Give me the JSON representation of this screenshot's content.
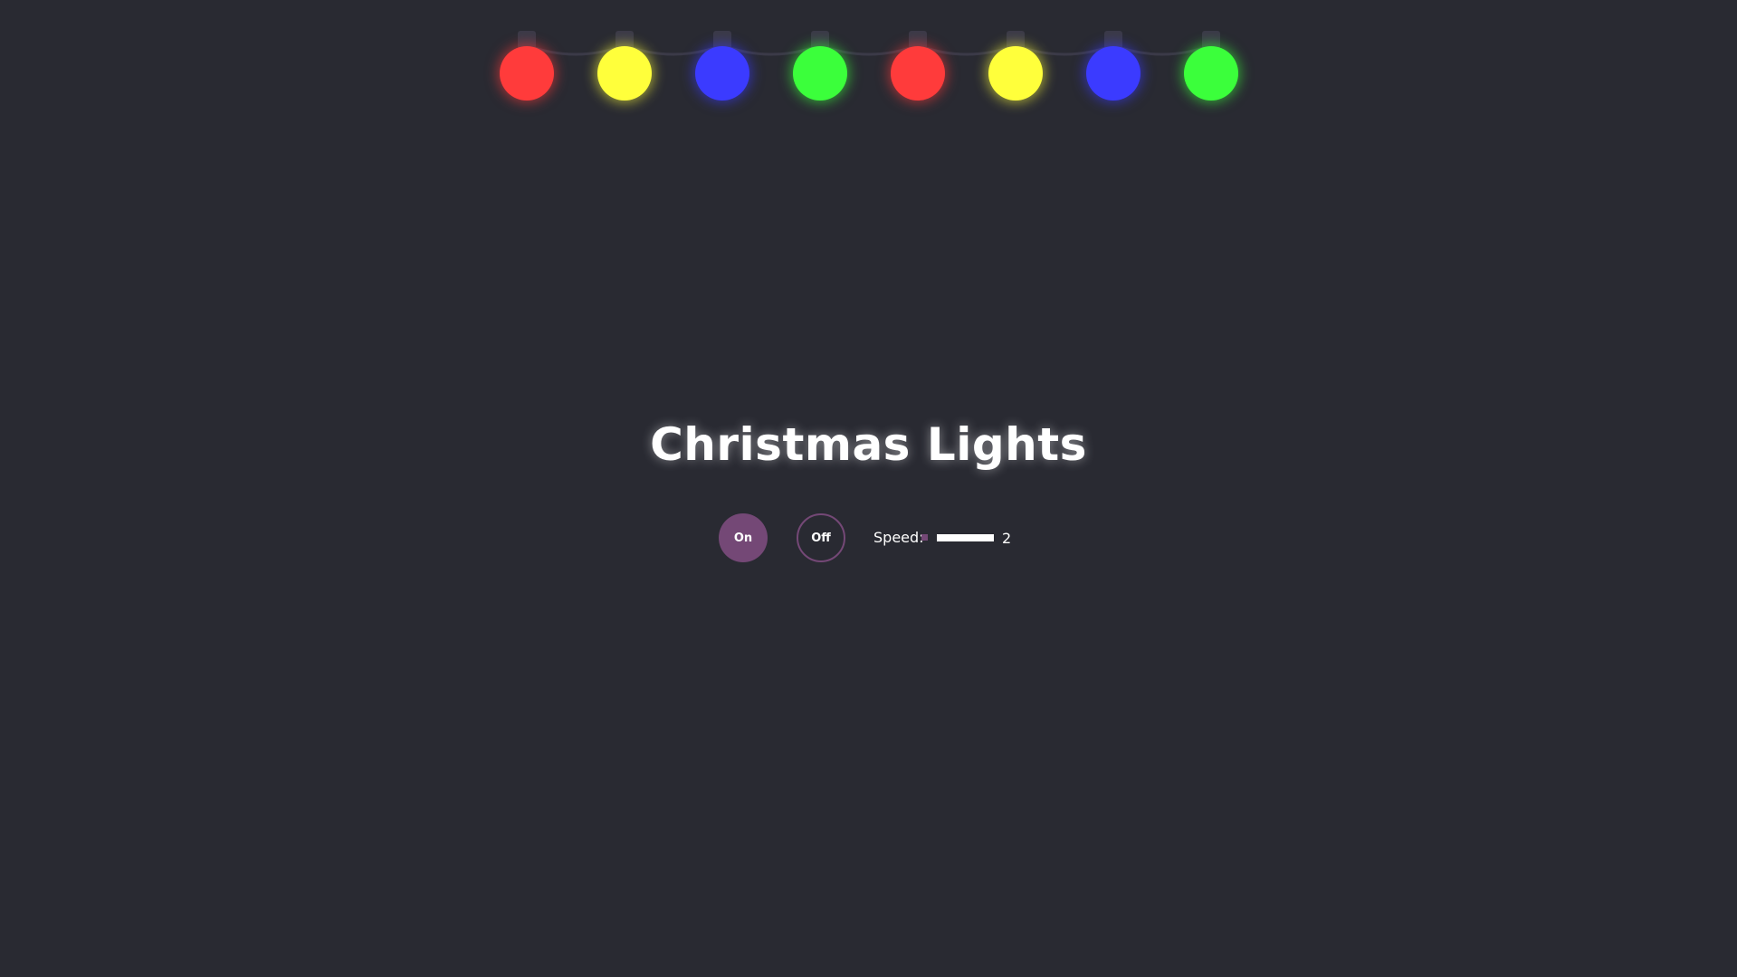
{
  "title": "Christmas Lights",
  "controls": {
    "on_label": "On",
    "off_label": "Off",
    "speed_label": "Speed:",
    "speed_value": "2"
  },
  "bulbs": [
    {
      "color": "#ff3b3b",
      "glow": "red-glow"
    },
    {
      "color": "#ffff3b",
      "glow": "yellow-glow"
    },
    {
      "color": "#3b3bff",
      "glow": "blue-glow"
    },
    {
      "color": "#3bff3b",
      "glow": "green-glow"
    },
    {
      "color": "#ff3b3b",
      "glow": "red-glow"
    },
    {
      "color": "#ffff3b",
      "glow": "yellow-glow"
    },
    {
      "color": "#3b3bff",
      "glow": "blue-glow"
    },
    {
      "color": "#3bff3b",
      "glow": "green-glow"
    }
  ],
  "colors": {
    "background": "#292a32",
    "accent": "#744876",
    "socket": "#3b3a48",
    "wire": "#3b3a48"
  }
}
